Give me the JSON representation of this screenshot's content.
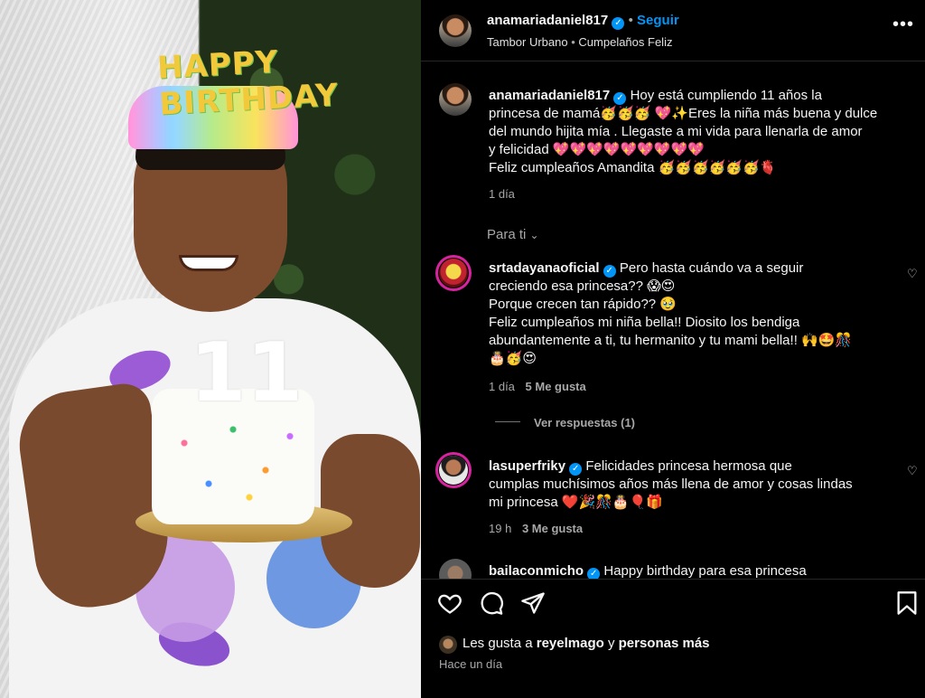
{
  "colors": {
    "accent": "#0095f6",
    "background": "#000000",
    "muted": "#a8a8a8",
    "story_ring": "#d6249f"
  },
  "photo": {
    "cake_number": "11",
    "crown_text": "HAPPY BIRTHDAY"
  },
  "header": {
    "username": "anamariadaniel817",
    "follow_label": "Seguir",
    "audio_artist": "Tambor Urbano",
    "audio_title": "Cumpelaños Feliz",
    "more_icon": "more-horizontal-icon"
  },
  "caption": {
    "username": "anamariadaniel817",
    "line1": "Hoy está cumpliendo 11 años la",
    "line2": "princesa de mamá🥳🥳🥳 💖✨Eres la niña más buena y dulce",
    "line3": "del mundo hijita mía . Llegaste a mi vida para llenarla de amor",
    "line4": "y felicidad 💖💖💖💖💖💖💖💖💖",
    "line5": "Feliz cumpleaños Amandita 🥳🥳🥳🥳🥳🥳🫀",
    "time": "1 día"
  },
  "sort": {
    "label": "Para ti"
  },
  "comments": [
    {
      "username": "srtadayanaoficial",
      "line1": "Pero hasta cuándo va a seguir",
      "line2": "creciendo esa princesa?? 😱😍",
      "line3": "Porque crecen tan rápido?? 🥹",
      "line4": "Feliz cumpleaños mi niña bella!! Diosito los bendiga",
      "line5": "abundantemente a ti, tu hermanito y tu mami bella!! 🙌🤩🎊",
      "line6": "🎂🥳😍",
      "time": "1 día",
      "likes": "5 Me gusta",
      "replies": "Ver respuestas (1)"
    },
    {
      "username": "lasuperfriky",
      "line1": "Felicidades princesa hermosa que",
      "line2": "cumplas muchísimos años más llena de amor y cosas lindas",
      "line3": "mi princesa ❤️🎉🎊🎂🎈🎁",
      "time": "19 h",
      "likes": "3 Me gusta"
    },
    {
      "username": "bailaconmicho",
      "line1": "Happy birthday para esa princesa"
    }
  ],
  "footer": {
    "likes_prefix": "Les gusta a",
    "likes_user": "reyelmago",
    "likes_and": "y",
    "likes_others": "personas más",
    "time": "Hace un día",
    "icons": [
      "heart-icon",
      "comment-icon",
      "share-icon",
      "bookmark-icon"
    ]
  }
}
